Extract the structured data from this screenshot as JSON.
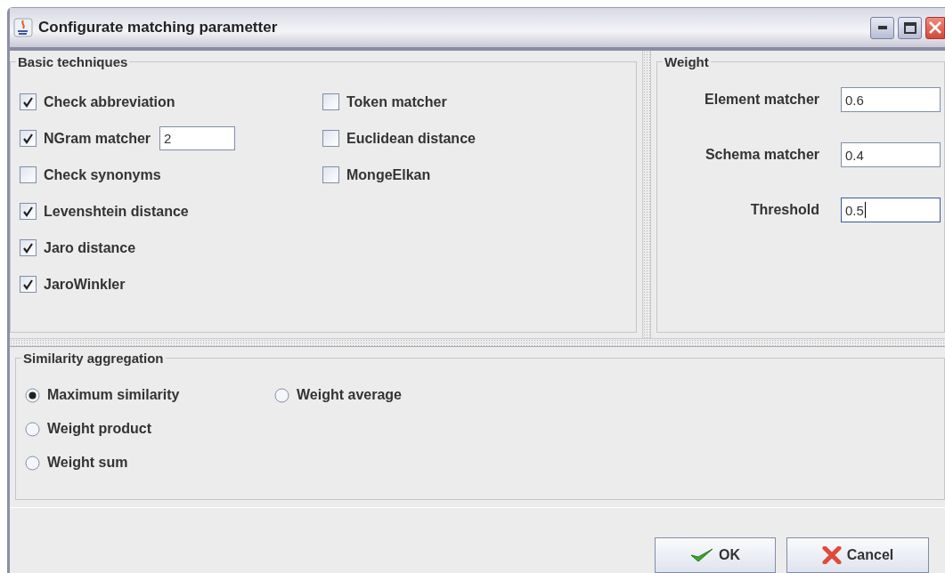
{
  "window": {
    "title": "Configurate matching parametter"
  },
  "basic_techniques": {
    "title": "Basic techniques",
    "column_1": [
      {
        "label": "Check abbreviation",
        "checked": true
      },
      {
        "label": "NGram matcher",
        "checked": true,
        "value": "2"
      },
      {
        "label": "Check synonyms",
        "checked": false
      },
      {
        "label": "Levenshtein distance",
        "checked": true
      },
      {
        "label": "Jaro distance",
        "checked": true
      },
      {
        "label": "JaroWinkler",
        "checked": true
      }
    ],
    "column_2": [
      {
        "label": "Token matcher",
        "checked": false
      },
      {
        "label": "Euclidean distance",
        "checked": false
      },
      {
        "label": "MongeElkan",
        "checked": false
      }
    ]
  },
  "weight": {
    "title": "Weight",
    "fields": [
      {
        "label": "Element matcher",
        "value": "0.6",
        "focused": false
      },
      {
        "label": "Schema matcher",
        "value": "0.4",
        "focused": false
      },
      {
        "label": "Threshold",
        "value": "0.5",
        "focused": true
      }
    ]
  },
  "similarity_aggregation": {
    "title": "Similarity aggregation",
    "options": [
      {
        "label": "Maximum similarity",
        "selected": true
      },
      {
        "label": "Weight average",
        "selected": false
      },
      {
        "label": "Weight product",
        "selected": false
      },
      {
        "label": "Weight sum",
        "selected": false
      }
    ]
  },
  "buttons": [
    {
      "label": "OK",
      "kind": "ok"
    },
    {
      "label": "Cancel",
      "kind": "cancel"
    }
  ]
}
